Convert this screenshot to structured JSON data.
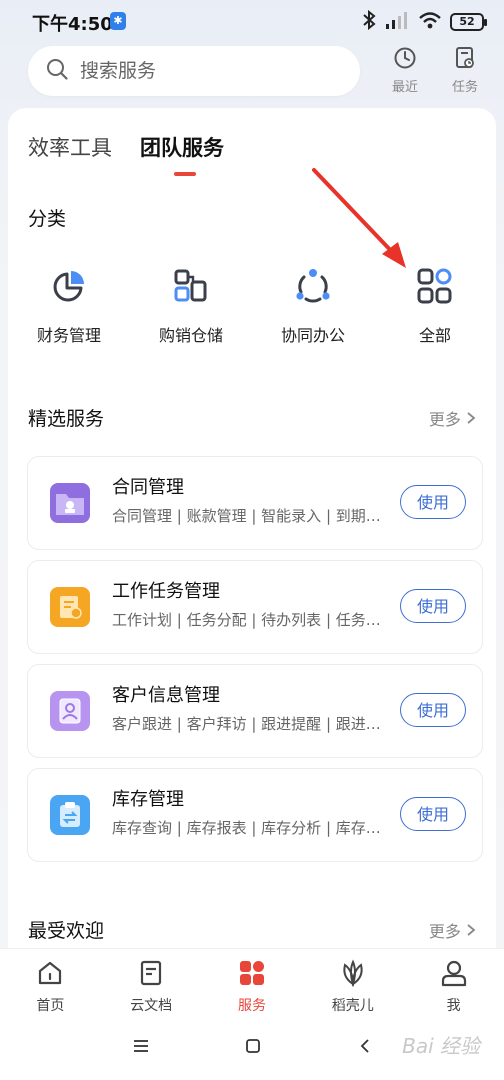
{
  "status": {
    "time": "下午4:50",
    "bt_badge": "✱",
    "battery": "52"
  },
  "search": {
    "placeholder": "搜索服务"
  },
  "top_actions": [
    {
      "label": "最近",
      "icon": "clock-icon"
    },
    {
      "label": "任务",
      "icon": "task-icon"
    }
  ],
  "tabs": [
    {
      "label": "效率工具"
    },
    {
      "label": "团队服务"
    }
  ],
  "categories": {
    "title": "分类",
    "items": [
      {
        "label": "财务管理",
        "icon": "pie-chart-icon"
      },
      {
        "label": "购销仓储",
        "icon": "boxes-icon"
      },
      {
        "label": "协同办公",
        "icon": "collaboration-icon"
      },
      {
        "label": "全部",
        "icon": "grid-icon"
      }
    ]
  },
  "featured": {
    "title": "精选服务",
    "more": "更多",
    "items": [
      {
        "name": "合同管理",
        "desc": "合同管理 | 账款管理 | 智能录入 | 到期提醒",
        "button": "使用",
        "icon": "contract-folder-icon"
      },
      {
        "name": "工作任务管理",
        "desc": "工作计划 | 任务分配 | 待办列表 | 任务跟踪",
        "button": "使用",
        "icon": "task-list-icon"
      },
      {
        "name": "客户信息管理",
        "desc": "客户跟进 | 客户拜访 | 跟进提醒 | 跟进记录",
        "button": "使用",
        "icon": "contact-card-icon"
      },
      {
        "name": "库存管理",
        "desc": "库存查询 | 库存报表 | 库存分析 | 库存预警",
        "button": "使用",
        "icon": "clipboard-swap-icon"
      }
    ]
  },
  "popular": {
    "title": "最受欢迎",
    "more": "更多"
  },
  "bottom_nav": [
    {
      "label": "首页",
      "icon": "home-icon"
    },
    {
      "label": "云文档",
      "icon": "document-icon"
    },
    {
      "label": "服务",
      "icon": "services-icon"
    },
    {
      "label": "稻壳儿",
      "icon": "leaf-icon"
    },
    {
      "label": "我",
      "icon": "person-icon"
    }
  ],
  "colors": {
    "accent": "#e8463a",
    "button_blue": "#3d6fd6"
  },
  "watermark": "Bai 经验"
}
